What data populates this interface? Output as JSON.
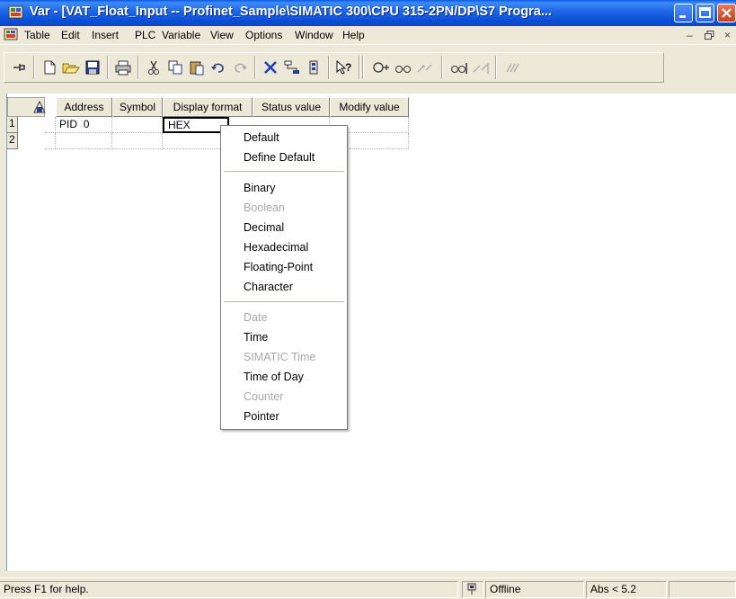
{
  "window": {
    "title": "Var - [VAT_Float_Input -- Profinet_Sample\\SIMATIC 300\\CPU 315-2PN/DP\\S7 Progra..."
  },
  "menubar": {
    "items": [
      "Table",
      "Edit",
      "Insert",
      "PLC",
      "Variable",
      "View",
      "Options",
      "Window",
      "Help"
    ]
  },
  "table": {
    "columns": [
      "Address",
      "Symbol",
      "Display format",
      "Status value",
      "Modify value"
    ],
    "rows": [
      {
        "num": "1",
        "address_area": "PID",
        "address_num": "0",
        "symbol": "",
        "display_format": "HEX",
        "status_value": "",
        "modify_value": ""
      },
      {
        "num": "2",
        "address_area": "",
        "address_num": "",
        "symbol": "",
        "display_format": "",
        "status_value": "",
        "modify_value": ""
      }
    ]
  },
  "context_menu": {
    "items": [
      {
        "label": "Default",
        "enabled": true
      },
      {
        "label": "Define Default",
        "enabled": true
      },
      {
        "label": "Binary",
        "enabled": true
      },
      {
        "label": "Boolean",
        "enabled": false
      },
      {
        "label": "Decimal",
        "enabled": true
      },
      {
        "label": "Hexadecimal",
        "enabled": true
      },
      {
        "label": "Floating-Point",
        "enabled": true
      },
      {
        "label": "Character",
        "enabled": true
      },
      {
        "label": "Date",
        "enabled": false
      },
      {
        "label": "Time",
        "enabled": true
      },
      {
        "label": "SIMATIC Time",
        "enabled": false
      },
      {
        "label": "Time of Day",
        "enabled": true
      },
      {
        "label": "Counter",
        "enabled": false
      },
      {
        "label": "Pointer",
        "enabled": true
      }
    ]
  },
  "statusbar": {
    "help": "Press F1 for help.",
    "connection": "Offline",
    "abs": "Abs < 5.2"
  },
  "icons": {
    "toolbar": [
      "pin-icon",
      "new-icon",
      "open-icon",
      "save-icon",
      "print-icon",
      "cut-icon",
      "copy-icon",
      "paste-icon",
      "undo-icon",
      "redo-icon",
      "delete-icon",
      "network-icon",
      "station-icon",
      "whats-this-icon",
      "monitor-icon",
      "monitor-glasses-icon",
      "modify-icon",
      "monitor-immediately-icon",
      "modify-immediately-icon",
      "force-icon"
    ]
  },
  "colors": {
    "titlebar": "#0a58e0",
    "chrome": "#ece9d8",
    "disabled_text": "#a8a8a8"
  }
}
